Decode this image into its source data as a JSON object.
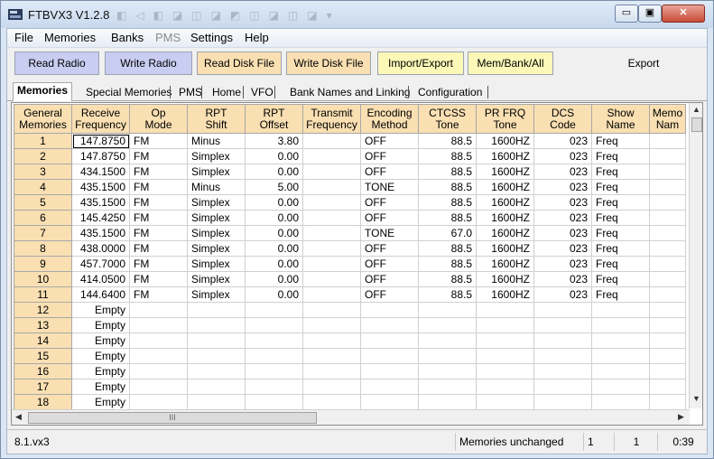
{
  "window": {
    "title": "FTBVX3 V1.2.8",
    "minimize_icon": "minimize-icon",
    "maximize_icon": "maximize-icon",
    "close_icon": "close-icon",
    "min_glyph": "▭",
    "max_glyph": "▣",
    "close_glyph": "✕"
  },
  "menu": [
    "File",
    "Memories",
    "Banks",
    "PMS",
    "Settings",
    "Help"
  ],
  "toolbar": {
    "read_radio": "Read Radio",
    "write_radio": "Write Radio",
    "read_disk": "Read Disk File",
    "write_disk": "Write Disk File",
    "import_export": "Import/Export",
    "mem_bank_all": "Mem/Bank/All",
    "export": "Export"
  },
  "tabs": [
    "Memories",
    "Special Memories",
    "PMS",
    "Home",
    "VFO",
    "Bank Names and Linking",
    "Configuration"
  ],
  "grid": {
    "headers": [
      [
        "General",
        "Memories"
      ],
      [
        "Receive",
        "Frequency"
      ],
      [
        "Op",
        "Mode"
      ],
      [
        "RPT",
        "Shift"
      ],
      [
        "RPT",
        "Offset"
      ],
      [
        "Transmit",
        "Frequency"
      ],
      [
        "Encoding",
        "Method"
      ],
      [
        "CTCSS",
        "Tone"
      ],
      [
        "PR FRQ",
        "Tone"
      ],
      [
        "DCS",
        "Code"
      ],
      [
        "Show",
        "Name"
      ],
      [
        "Memo",
        "Nam"
      ]
    ],
    "rows": [
      [
        "1",
        "147.8750",
        "FM",
        "Minus",
        "3.80",
        "",
        "OFF",
        "88.5",
        "1600HZ",
        "023",
        "Freq",
        ""
      ],
      [
        "2",
        "147.8750",
        "FM",
        "Simplex",
        "0.00",
        "",
        "OFF",
        "88.5",
        "1600HZ",
        "023",
        "Freq",
        ""
      ],
      [
        "3",
        "434.1500",
        "FM",
        "Simplex",
        "0.00",
        "",
        "OFF",
        "88.5",
        "1600HZ",
        "023",
        "Freq",
        ""
      ],
      [
        "4",
        "435.1500",
        "FM",
        "Minus",
        "5.00",
        "",
        "TONE",
        "88.5",
        "1600HZ",
        "023",
        "Freq",
        ""
      ],
      [
        "5",
        "435.1500",
        "FM",
        "Simplex",
        "0.00",
        "",
        "OFF",
        "88.5",
        "1600HZ",
        "023",
        "Freq",
        ""
      ],
      [
        "6",
        "145.4250",
        "FM",
        "Simplex",
        "0.00",
        "",
        "OFF",
        "88.5",
        "1600HZ",
        "023",
        "Freq",
        ""
      ],
      [
        "7",
        "435.1500",
        "FM",
        "Simplex",
        "0.00",
        "",
        "TONE",
        "67.0",
        "1600HZ",
        "023",
        "Freq",
        ""
      ],
      [
        "8",
        "438.0000",
        "FM",
        "Simplex",
        "0.00",
        "",
        "OFF",
        "88.5",
        "1600HZ",
        "023",
        "Freq",
        ""
      ],
      [
        "9",
        "457.7000",
        "FM",
        "Simplex",
        "0.00",
        "",
        "OFF",
        "88.5",
        "1600HZ",
        "023",
        "Freq",
        ""
      ],
      [
        "10",
        "414.0500",
        "FM",
        "Simplex",
        "0.00",
        "",
        "OFF",
        "88.5",
        "1600HZ",
        "023",
        "Freq",
        ""
      ],
      [
        "11",
        "144.6400",
        "FM",
        "Simplex",
        "0.00",
        "",
        "OFF",
        "88.5",
        "1600HZ",
        "023",
        "Freq",
        ""
      ],
      [
        "12",
        "Empty",
        "",
        "",
        "",
        "",
        "",
        "",
        "",
        "",
        "",
        ""
      ],
      [
        "13",
        "Empty",
        "",
        "",
        "",
        "",
        "",
        "",
        "",
        "",
        "",
        ""
      ],
      [
        "14",
        "Empty",
        "",
        "",
        "",
        "",
        "",
        "",
        "",
        "",
        "",
        ""
      ],
      [
        "15",
        "Empty",
        "",
        "",
        "",
        "",
        "",
        "",
        "",
        "",
        "",
        ""
      ],
      [
        "16",
        "Empty",
        "",
        "",
        "",
        "",
        "",
        "",
        "",
        "",
        "",
        ""
      ],
      [
        "17",
        "Empty",
        "",
        "",
        "",
        "",
        "",
        "",
        "",
        "",
        "",
        ""
      ],
      [
        "18",
        "Empty",
        "",
        "",
        "",
        "",
        "",
        "",
        "",
        "",
        "",
        ""
      ]
    ],
    "selected": {
      "row": 0,
      "col": 1
    },
    "hscroll_grip": "III"
  },
  "status": {
    "file": "8.1.vx3",
    "state": "Memories unchanged",
    "field_a": "1",
    "field_b": "1",
    "time": "0:39"
  },
  "colors": {
    "header_bg": "#f9dfb2",
    "read_radio_bg": "#c9cdf2",
    "write_disk_bg": "#f9dfb2",
    "import_bg": "#fbf8b8"
  }
}
